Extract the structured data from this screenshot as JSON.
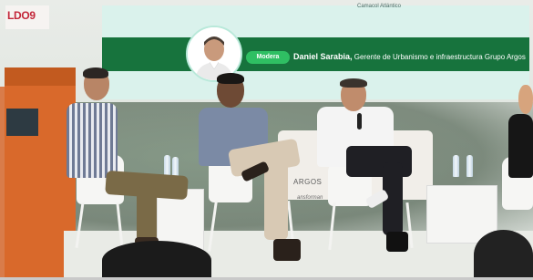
{
  "logo": {
    "text": "LDO9"
  },
  "screen": {
    "caption": "Camacol Atlántico",
    "badge": "Modera",
    "moderator_name": "Daniel Sarabia,",
    "moderator_role": " Gerente de Urbanismo e infraestructura Grupo Argos"
  },
  "backdrop": {
    "brand": "ARGOS",
    "tagline": "ansforman"
  },
  "colors": {
    "banner": "#17733d",
    "badge": "#2fbf63",
    "screen": "#daf2ec",
    "podium": "#d9692b",
    "logo_accent": "#c3273a"
  }
}
